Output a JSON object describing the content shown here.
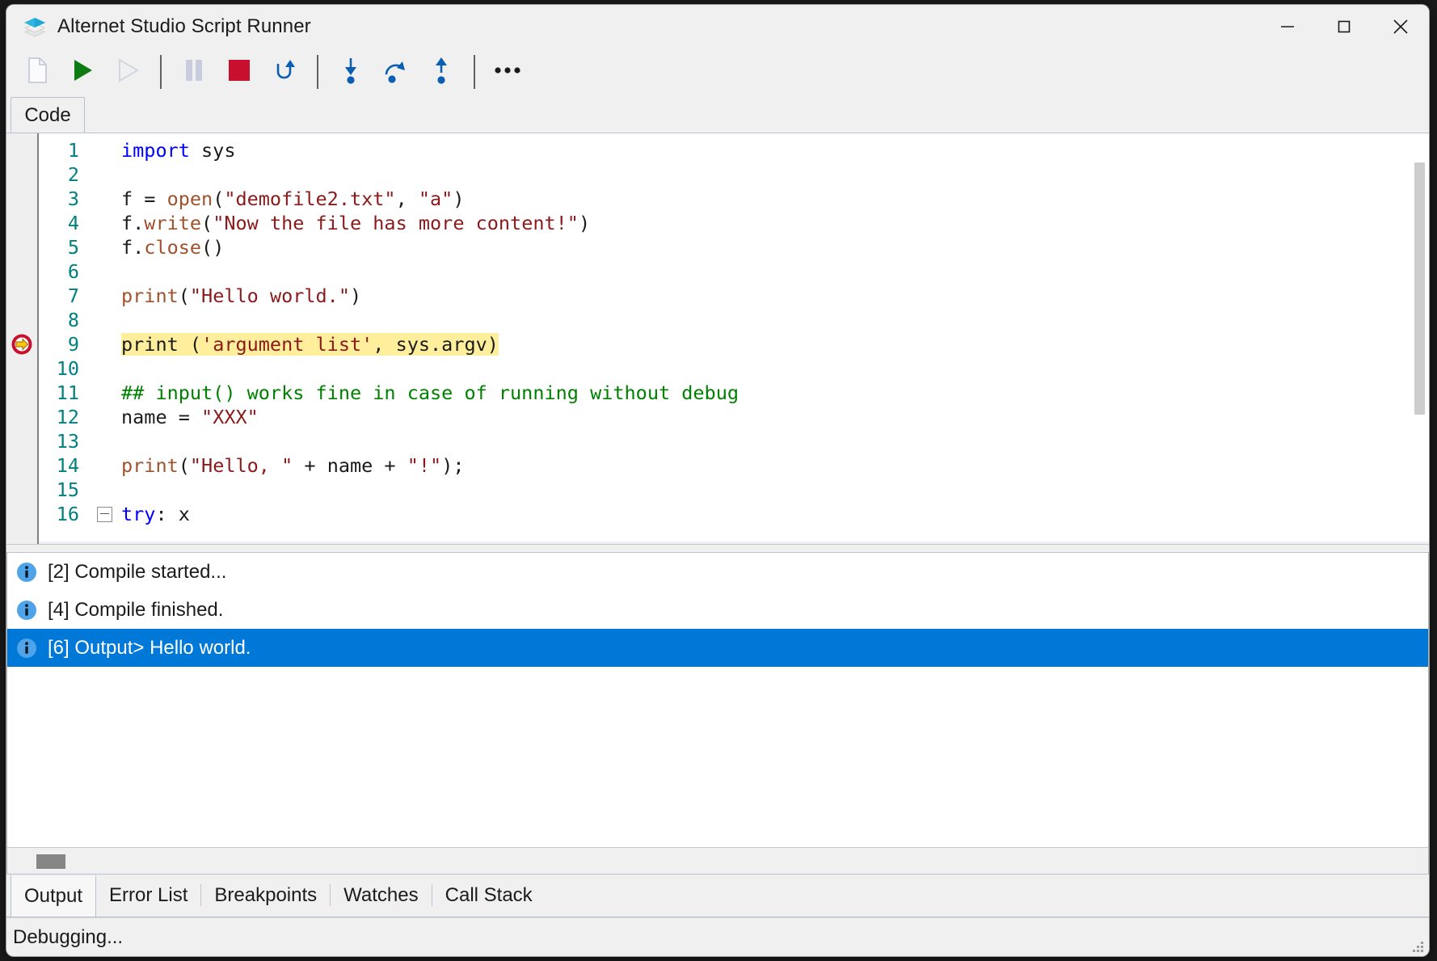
{
  "window": {
    "title": "Alternet Studio Script Runner",
    "app_icon": "layers-icon",
    "caption": {
      "minimize": "minimize-icon",
      "maximize": "maximize-icon",
      "close": "close-icon"
    }
  },
  "toolbar": {
    "buttons": [
      {
        "name": "new-file-button",
        "icon": "new-file-icon",
        "title": "New",
        "enabled": false
      },
      {
        "name": "run-button",
        "icon": "play-icon",
        "title": "Run",
        "enabled": true
      },
      {
        "name": "run-without-debug-button",
        "icon": "play-outline-icon",
        "title": "Run without debugging",
        "enabled": false
      },
      {
        "name": "pause-button",
        "icon": "pause-icon",
        "title": "Pause",
        "enabled": false
      },
      {
        "name": "stop-button",
        "icon": "stop-icon",
        "title": "Stop",
        "enabled": true
      },
      {
        "name": "restart-button",
        "icon": "restart-icon",
        "title": "Restart",
        "enabled": true
      },
      {
        "name": "step-into-button",
        "icon": "step-into-icon",
        "title": "Step Into",
        "enabled": true
      },
      {
        "name": "step-over-button",
        "icon": "step-over-icon",
        "title": "Step Over",
        "enabled": true
      },
      {
        "name": "step-out-button",
        "icon": "step-out-icon",
        "title": "Step Out",
        "enabled": true
      },
      {
        "name": "more-button",
        "icon": "ellipsis-icon",
        "title": "More",
        "enabled": true
      }
    ]
  },
  "editor": {
    "tab_label": "Code",
    "current_execution_line": 9,
    "highlight_color": "#ffef9c",
    "lineno_color": "#008080",
    "lines": [
      {
        "no": "1",
        "fold": false,
        "tokens": [
          {
            "t": "import",
            "c": "k"
          },
          {
            "t": " sys",
            "c": "pl"
          }
        ]
      },
      {
        "no": "2",
        "fold": false,
        "tokens": []
      },
      {
        "no": "3",
        "fold": false,
        "tokens": [
          {
            "t": "f = ",
            "c": "pl"
          },
          {
            "t": "open",
            "c": "fn"
          },
          {
            "t": "(",
            "c": "pl"
          },
          {
            "t": "\"demofile2.txt\"",
            "c": "st"
          },
          {
            "t": ", ",
            "c": "pl"
          },
          {
            "t": "\"a\"",
            "c": "st"
          },
          {
            "t": ")",
            "c": "pl"
          }
        ]
      },
      {
        "no": "4",
        "fold": false,
        "tokens": [
          {
            "t": "f.",
            "c": "pl"
          },
          {
            "t": "write",
            "c": "fn"
          },
          {
            "t": "(",
            "c": "pl"
          },
          {
            "t": "\"Now the file has more content!\"",
            "c": "st"
          },
          {
            "t": ")",
            "c": "pl"
          }
        ]
      },
      {
        "no": "5",
        "fold": false,
        "tokens": [
          {
            "t": "f.",
            "c": "pl"
          },
          {
            "t": "close",
            "c": "fn"
          },
          {
            "t": "()",
            "c": "pl"
          }
        ]
      },
      {
        "no": "6",
        "fold": false,
        "tokens": []
      },
      {
        "no": "7",
        "fold": false,
        "tokens": [
          {
            "t": "print",
            "c": "fn"
          },
          {
            "t": "(",
            "c": "pl"
          },
          {
            "t": "\"Hello world.\"",
            "c": "st"
          },
          {
            "t": ")",
            "c": "pl"
          }
        ]
      },
      {
        "no": "8",
        "fold": false,
        "tokens": []
      },
      {
        "no": "9",
        "fold": false,
        "highlight": true,
        "tokens": [
          {
            "t": "print (",
            "c": "pl"
          },
          {
            "t": "'argument list'",
            "c": "st"
          },
          {
            "t": ", sys.argv)",
            "c": "pl"
          }
        ]
      },
      {
        "no": "10",
        "fold": false,
        "tokens": []
      },
      {
        "no": "11",
        "fold": false,
        "tokens": [
          {
            "t": "## input() works fine in case of running without debug",
            "c": "cm"
          }
        ]
      },
      {
        "no": "12",
        "fold": false,
        "tokens": [
          {
            "t": "name = ",
            "c": "pl"
          },
          {
            "t": "\"XXX\"",
            "c": "st"
          }
        ]
      },
      {
        "no": "13",
        "fold": false,
        "tokens": []
      },
      {
        "no": "14",
        "fold": false,
        "tokens": [
          {
            "t": "print",
            "c": "fn"
          },
          {
            "t": "(",
            "c": "pl"
          },
          {
            "t": "\"Hello, \"",
            "c": "st"
          },
          {
            "t": " + name + ",
            "c": "pl"
          },
          {
            "t": "\"!\"",
            "c": "st"
          },
          {
            "t": ");",
            "c": "pl"
          }
        ]
      },
      {
        "no": "15",
        "fold": false,
        "tokens": []
      },
      {
        "no": "16",
        "fold": true,
        "tokens": [
          {
            "t": "try",
            "c": "k"
          },
          {
            "t": ": x",
            "c": "pl"
          }
        ]
      }
    ]
  },
  "output": {
    "rows": [
      {
        "icon": "info-icon",
        "text": "[2] Compile started...",
        "selected": false
      },
      {
        "icon": "info-icon",
        "text": "[4] Compile finished.",
        "selected": false
      },
      {
        "icon": "info-icon",
        "text": "[6] Output> Hello world.",
        "selected": true
      }
    ],
    "selection_color": "#0078d7"
  },
  "bottom_tabs": [
    {
      "label": "Output",
      "active": true
    },
    {
      "label": "Error List",
      "active": false
    },
    {
      "label": "Breakpoints",
      "active": false
    },
    {
      "label": "Watches",
      "active": false
    },
    {
      "label": "Call Stack",
      "active": false
    }
  ],
  "statusbar": {
    "text": "Debugging..."
  }
}
